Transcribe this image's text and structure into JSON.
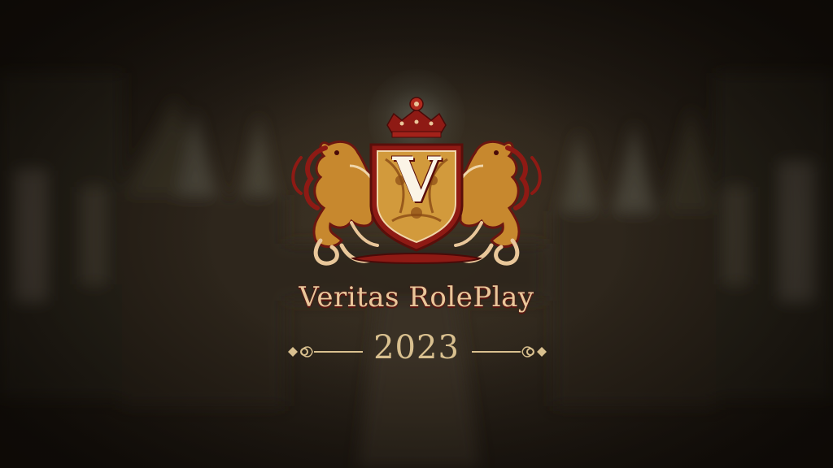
{
  "logo": {
    "monogram": "V",
    "icon": "lion-crest-icon",
    "crown_icon": "crown-icon"
  },
  "title": "Veritas RolePlay",
  "year": "2023",
  "colors": {
    "crest_red": "#8e1a14",
    "crest_gold": "#c9902f",
    "text_gold": "#e9c79a",
    "background": "#261f17"
  }
}
